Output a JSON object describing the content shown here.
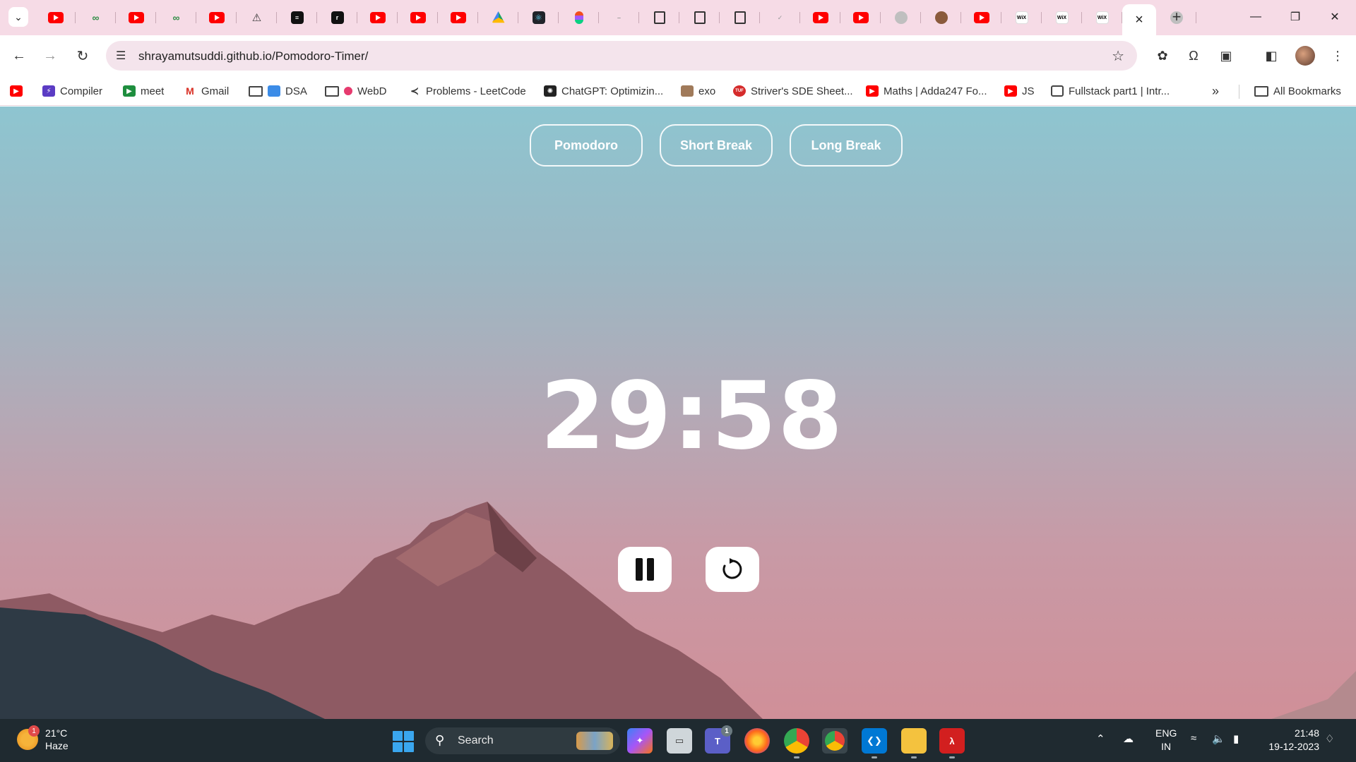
{
  "browser": {
    "url": "shrayamutsuddi.github.io/Pomodoro-Timer/",
    "tabs": [
      {
        "icon": "youtube-icon"
      },
      {
        "icon": "gfg-icon"
      },
      {
        "icon": "youtube-icon"
      },
      {
        "icon": "gfg-icon"
      },
      {
        "icon": "youtube-icon"
      },
      {
        "icon": "bell-icon"
      },
      {
        "icon": "black-app-icon"
      },
      {
        "icon": "black-app-icon"
      },
      {
        "icon": "youtube-icon"
      },
      {
        "icon": "youtube-icon"
      },
      {
        "icon": "youtube-icon"
      },
      {
        "icon": "drive-icon"
      },
      {
        "icon": "react-icon"
      },
      {
        "icon": "figma-icon"
      },
      {
        "icon": "dash-icon"
      },
      {
        "icon": "doc-icon"
      },
      {
        "icon": "doc-icon"
      },
      {
        "icon": "doc-icon"
      },
      {
        "icon": "app-icon"
      },
      {
        "icon": "youtube-icon"
      },
      {
        "icon": "youtube-icon"
      },
      {
        "icon": "globe-icon"
      },
      {
        "icon": "face-icon"
      },
      {
        "icon": "youtube-icon"
      },
      {
        "icon": "wix-icon"
      },
      {
        "icon": "wix-icon"
      },
      {
        "icon": "wix-icon"
      }
    ],
    "wix_label": "WiX",
    "bookmarks": [
      {
        "label": "Compiler",
        "icon": "compiler-icon"
      },
      {
        "label": "meet",
        "icon": "meet-icon"
      },
      {
        "label": "Gmail",
        "icon": "gmail-icon"
      },
      {
        "label": "DSA",
        "icon": "folder-icon"
      },
      {
        "label": "WebD",
        "icon": "folder-icon"
      },
      {
        "label": "Problems - LeetCode",
        "icon": "leetcode-icon"
      },
      {
        "label": "ChatGPT: Optimizin...",
        "icon": "chatgpt-icon"
      },
      {
        "label": "exo",
        "icon": "exo-icon"
      },
      {
        "label": "Striver's SDE Sheet...",
        "icon": "tuf-icon"
      },
      {
        "label": "Maths | Adda247 Fo...",
        "icon": "youtube-icon"
      },
      {
        "label": "JS",
        "icon": "youtube-icon"
      },
      {
        "label": "Fullstack part1 | Intr...",
        "icon": "page-icon"
      }
    ],
    "all_bookmarks": "All Bookmarks"
  },
  "app": {
    "modes": [
      "Pomodoro",
      "Short Break",
      "Long Break"
    ],
    "timer": "29:58",
    "colors": {
      "sky_top": "#8ec5d0",
      "sky_bottom": "#d08f98",
      "mountain": "#8c5a62"
    }
  },
  "taskbar": {
    "weather": {
      "temp": "21°C",
      "desc": "Haze",
      "badge": "1"
    },
    "search_label": "Search",
    "teams_badge": "1",
    "lang": {
      "line1": "ENG",
      "line2": "IN"
    },
    "clock": {
      "time": "21:48",
      "date": "19-12-2023"
    }
  }
}
